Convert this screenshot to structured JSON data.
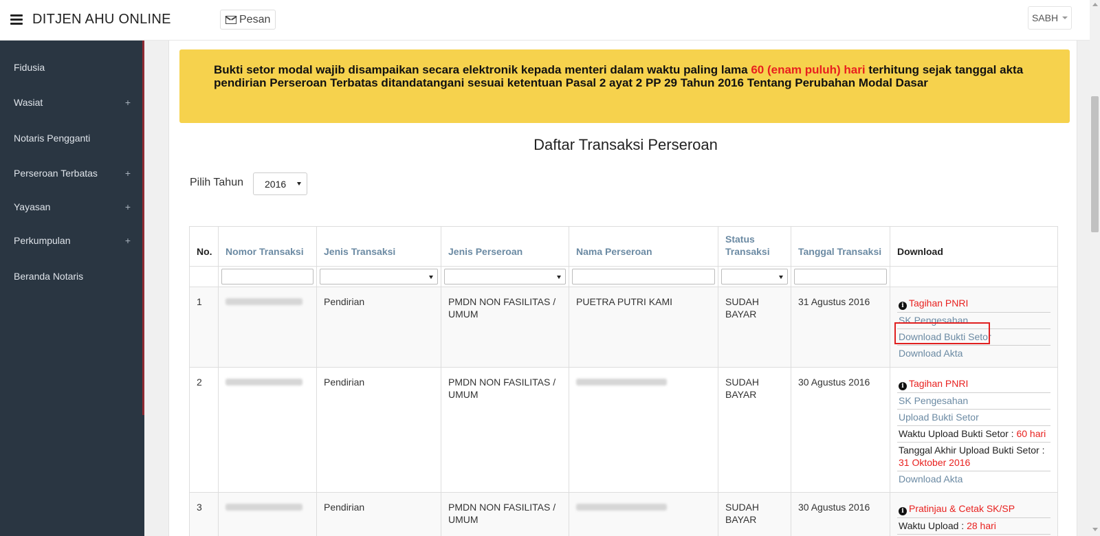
{
  "header": {
    "brand": "DITJEN AHU ONLINE",
    "pesan_label": "Pesan",
    "user_label": "SABH"
  },
  "sidebar": {
    "items": [
      {
        "label": "Fidusia",
        "expandable": ""
      },
      {
        "label": "Wasiat",
        "expandable": "+"
      },
      {
        "label": "Notaris Pengganti",
        "expandable": ""
      },
      {
        "label": "Perseroan Terbatas",
        "expandable": "+"
      },
      {
        "label": "Yayasan",
        "expandable": "+"
      },
      {
        "label": "Perkumpulan",
        "expandable": "+"
      },
      {
        "label": "Beranda Notaris",
        "expandable": ""
      }
    ]
  },
  "notice": {
    "part1": "Bukti setor modal wajib disampaikan secara elektronik kepada menteri dalam waktu paling lama ",
    "highlight": "60 (enam puluh) hari",
    "part2": " terhitung sejak tanggal akta pendirian Perseroan Terbatas ditandatangani sesuai ketentuan Pasal 2 ayat 2 PP 29 Tahun 2016 Tentang Perubahan Modal Dasar"
  },
  "page_title": "Daftar Transaksi Perseroan",
  "year_filter": {
    "label": "Pilih Tahun",
    "value": "2016"
  },
  "table": {
    "columns": [
      "No.",
      "Nomor Transaksi",
      "Jenis Transaksi",
      "Jenis Perseroan",
      "Nama Perseroan",
      "Status Transaksi",
      "Tanggal Transaksi",
      "Download"
    ],
    "rows": [
      {
        "no": "1",
        "jenis_transaksi": "Pendirian",
        "jenis_perseroan": "PMDN NON FASILITAS / UMUM",
        "nama_perseroan": "PUETRA PUTRI KAMI",
        "status": "SUDAH BAYAR",
        "tanggal": "31 Agustus 2016",
        "downloads": {
          "tagihan": "Tagihan PNRI",
          "sk": "SK Pengesahan",
          "bukti_setor": "Download Bukti Setor",
          "akta": "Download Akta"
        }
      },
      {
        "no": "2",
        "jenis_transaksi": "Pendirian",
        "jenis_perseroan": "PMDN NON FASILITAS / UMUM",
        "status": "SUDAH BAYAR",
        "tanggal": "30 Agustus 2016",
        "downloads": {
          "tagihan": "Tagihan PNRI",
          "sk": "SK Pengesahan",
          "upload_bukti": "Upload Bukti Setor",
          "waktu_label": "Waktu Upload Bukti Setor : ",
          "waktu_value": "60 hari",
          "akhir_label": "Tanggal Akhir Upload Bukti Setor : ",
          "akhir_value": "31 Oktober 2016",
          "akta": "Download Akta"
        }
      },
      {
        "no": "3",
        "jenis_transaksi": "Pendirian",
        "jenis_perseroan": "PMDN NON FASILITAS / UMUM",
        "status": "SUDAH BAYAR",
        "tanggal": "30 Agustus 2016",
        "downloads": {
          "pratinjau": "Pratinjau & Cetak SK/SP",
          "waktu_label": "Waktu Upload : ",
          "waktu_value": "28 hari"
        }
      }
    ]
  },
  "colors": {
    "sidebar_bg": "#2a3642",
    "notice_bg": "#f6d24d",
    "accent_red": "#e8201e",
    "link_blue": "#6b8aa3",
    "status_green": "#3c8d2f"
  }
}
